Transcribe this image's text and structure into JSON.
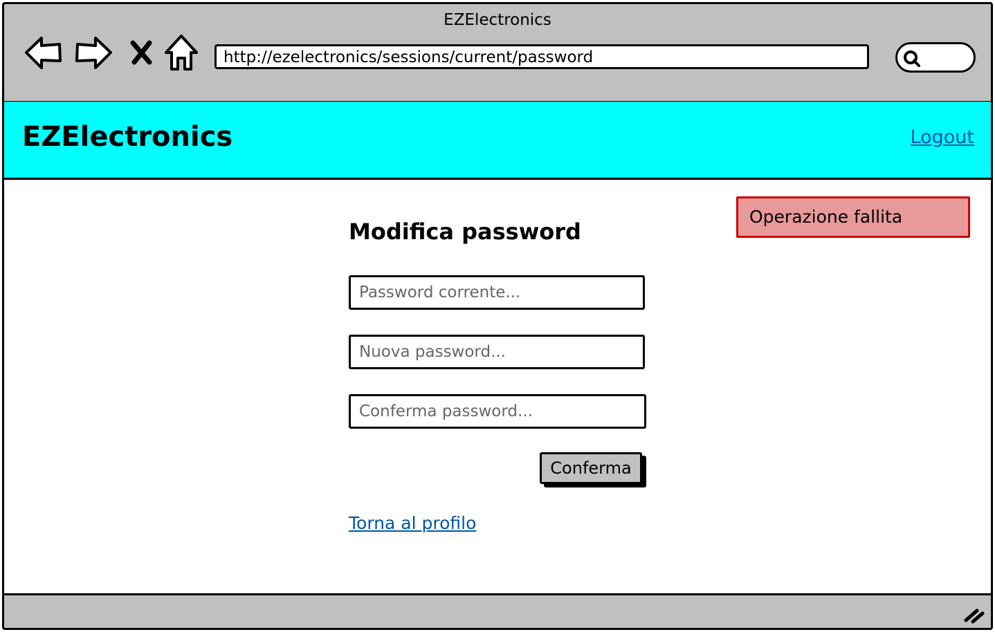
{
  "browser": {
    "window_title": "EZElectronics",
    "url": "http://ezelectronics/sessions/current/password",
    "icons": {
      "back": "back-arrow-icon",
      "forward": "forward-arrow-icon",
      "stop": "close-icon",
      "home": "home-icon",
      "search": "search-icon",
      "resize": "resize-grip-icon"
    }
  },
  "header": {
    "brand": "EZElectronics",
    "logout_label": "Logout",
    "background_color": "#00ffff"
  },
  "alert": {
    "message": "Operazione fallita",
    "border_color": "#d10000",
    "background_color": "#e8999a"
  },
  "form": {
    "title": "Modifica password",
    "current_password_placeholder": "Password corrente...",
    "new_password_placeholder": "Nuova password...",
    "confirm_password_placeholder": "Conferma password...",
    "submit_label": "Conferma",
    "back_link": "Torna al profilo",
    "link_color": "#0055aa"
  }
}
